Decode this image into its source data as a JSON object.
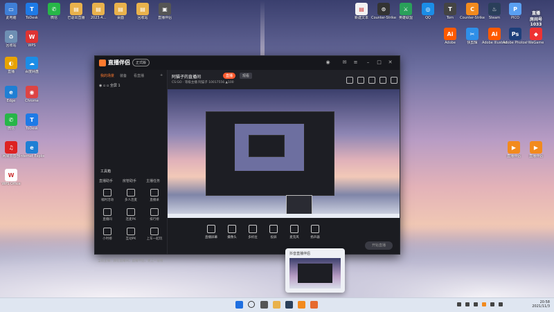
{
  "desktop": {
    "left_icons": [
      {
        "label": "此电脑",
        "color": "#3f7fd6",
        "glyph": "▭"
      },
      {
        "label": "ToDesk",
        "color": "#1e7ae6",
        "glyph": "T"
      },
      {
        "label": "微信",
        "color": "#27b648",
        "glyph": "✆"
      },
      {
        "label": "已退出直播",
        "color": "#e9b24c",
        "glyph": "▤"
      },
      {
        "label": "2023.4...",
        "color": "#e9b24c",
        "glyph": "▤"
      },
      {
        "label": "桌面",
        "color": "#e9b24c",
        "glyph": "▤"
      },
      {
        "label": "回收站",
        "color": "#e9b24c",
        "glyph": "▤"
      },
      {
        "label": "直播伴侣",
        "color": "#555",
        "glyph": "▣"
      },
      {
        "label": "回收站",
        "color": "#6e8fb3",
        "glyph": "♻"
      },
      {
        "label": "WPS",
        "color": "#d33",
        "glyph": "W"
      },
      {
        "label": "直播",
        "color": "#e8a300",
        "glyph": "◐"
      },
      {
        "label": "百度网盘",
        "color": "#1b8de6",
        "glyph": "☁"
      },
      {
        "label": "Edge",
        "color": "#1f7fd4",
        "glyph": "e"
      },
      {
        "label": "Chrome",
        "color": "#d44",
        "glyph": "◉"
      },
      {
        "label": "微信",
        "color": "#27b648",
        "glyph": "✆"
      },
      {
        "label": "ToDesk",
        "color": "#1e7ae6",
        "glyph": "T"
      },
      {
        "label": "网易云音乐",
        "color": "#d22",
        "glyph": "♫"
      },
      {
        "label": "Internet Explorer",
        "color": "#1f7fd4",
        "glyph": "e"
      },
      {
        "label": "WPS Office",
        "color": "#fff",
        "glyph": "W"
      }
    ],
    "right_icons": [
      {
        "label": "新建文本",
        "color": "#f2f2f2",
        "glyph": "▤"
      },
      {
        "label": "Counter-Strike",
        "color": "#333",
        "glyph": "⊙"
      },
      {
        "label": "英雄联盟",
        "color": "#2aa05a",
        "glyph": "⚔"
      },
      {
        "label": "QQ",
        "color": "#1b8de6",
        "glyph": "◎"
      },
      {
        "label": "Tom",
        "color": "#444",
        "glyph": "T"
      },
      {
        "label": "Counter-Strike",
        "color": "#f28a1e",
        "glyph": "C"
      },
      {
        "label": "Steam",
        "color": "#2a3f5a",
        "glyph": "♨"
      },
      {
        "label": "PICO",
        "color": "#5aa0f2",
        "glyph": "P"
      },
      {
        "label": "Adobe",
        "color": "#ff5a00",
        "glyph": "Ai"
      },
      {
        "label": "快剪辑",
        "color": "#2f8fe8",
        "glyph": "✂"
      },
      {
        "label": "Adobe Illustrator",
        "color": "#ff5a00",
        "glyph": "Ai"
      },
      {
        "label": "Adobe Photoshop",
        "color": "#1d3f7a",
        "glyph": "Ps"
      },
      {
        "label": "WeGame",
        "color": "#e33",
        "glyph": "◆"
      },
      {
        "label": "直播伴侣",
        "color": "#f28a1e",
        "glyph": "▶"
      },
      {
        "label": "直播伴侣",
        "color": "#f28a1e",
        "glyph": "▶"
      }
    ],
    "watermark": "直播\n房间号\n1033"
  },
  "app": {
    "name": "直播伴侣",
    "version": "正式版",
    "left_tabs": [
      "我的场景",
      "装备",
      "看直播"
    ],
    "scene_label": "全屏 1",
    "tools_title": "工具箱",
    "tool_tabs": [
      "直播助手",
      "房管助手",
      "主播任务"
    ],
    "tools": [
      "福利活动",
      "多人连麦",
      "直播录",
      "直播间",
      "连麦PK",
      "排行榜",
      "小时榜",
      "互动PK",
      "上车一起玩"
    ],
    "footer": "当前主播：我在直播间，直播伴侣，更上一层楼",
    "room_title": "阿猫子的直播间",
    "room_badge": "直播",
    "room_badge2": "观看",
    "room_meta": "CS:GO · 等级主播   阿猫子  10017556   ▲100",
    "bottom_tools": [
      "直播屏幕",
      "摄像头",
      "多机位",
      "投屏",
      "麦克风",
      "扬声器"
    ],
    "live_button": "开始直播"
  },
  "popup": {
    "title": "抖音直播伴侣"
  },
  "taskbar": {
    "time": "20:58",
    "date": "2021/11/3"
  }
}
